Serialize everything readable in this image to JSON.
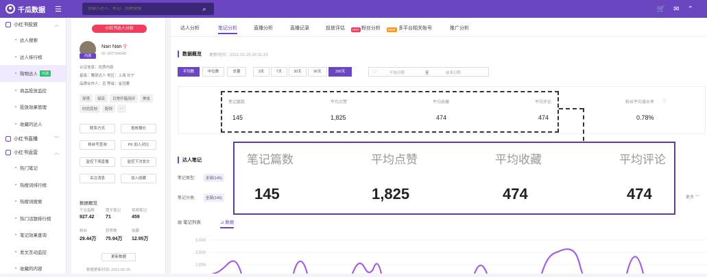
{
  "app": {
    "name": "千瓜数据"
  },
  "search": {
    "placeholder": "请输入达人、笔记、品牌搜搜"
  },
  "sidebar": {
    "sections": [
      {
        "label": "小红书投放"
      },
      {
        "label": "小红书直播"
      },
      {
        "label": "小红书运营"
      }
    ],
    "group1": [
      {
        "label": "达人搜索"
      },
      {
        "label": "达人排行榜"
      },
      {
        "label": "购物达人",
        "badge": "内测"
      },
      {
        "label": "商品投放监控"
      },
      {
        "label": "投放效果管理"
      },
      {
        "label": "收藏的达人"
      }
    ],
    "group3": [
      {
        "label": "热门笔记"
      },
      {
        "label": "热搜词排行榜"
      },
      {
        "label": "热搜词搜索"
      },
      {
        "label": "热门话题排行榜"
      },
      {
        "label": "笔记效果查询"
      },
      {
        "label": "发文互动监控"
      },
      {
        "label": "收藏的内容"
      }
    ]
  },
  "profile": {
    "tag": "小红书达人分析",
    "name": "Nan Nan",
    "id": "ID: 907794345",
    "avatar_badge": "内测",
    "info": [
      "认证信息：优质内容",
      "星级：腰部达人   地区：上海 长宁",
      "品牌合作人：否   等级：金冠薯"
    ],
    "chips": [
      "穿搭",
      "探店",
      "日常开箱测评",
      "美妆",
      "时尚其他",
      "配饰",
      "..."
    ],
    "buttons": [
      "联系方式",
      "投放报价",
      "粉丝号查询",
      "PK 加入对比",
      "监控下场直播",
      "监控下次发文",
      "关注消息",
      "加入收藏"
    ],
    "stats_title": "数据概览",
    "stats": [
      {
        "label": "千瓜指数",
        "value": "927.42"
      },
      {
        "label": "图文笔记",
        "value": "71"
      },
      {
        "label": "视频笔记",
        "value": "459"
      },
      {
        "label": "粉丝",
        "value": "29.44万"
      },
      {
        "label": "获赞数",
        "value": "75.94万"
      },
      {
        "label": "收藏",
        "value": "12.95万"
      }
    ],
    "refresh": "更新数据",
    "update_time": "数据更新时间: 2021-02-25"
  },
  "tabs": [
    {
      "label": "达人分析"
    },
    {
      "label": "笔记分析",
      "active": true
    },
    {
      "label": "直播分析"
    },
    {
      "label": "直播记录"
    },
    {
      "label": "投放评估",
      "badge": "HOT"
    },
    {
      "label": "粉丝分析",
      "badge": "NEW"
    },
    {
      "label": "多平台相关账号"
    },
    {
      "label": "推广分析"
    }
  ],
  "overview": {
    "title": "数据概览",
    "update": "更新时间：2021-02-25 00:31:23",
    "segments": [
      "平均数",
      "中位数",
      "总量",
      "3天",
      "7天",
      "30天",
      "90天",
      "180天"
    ],
    "date_start": "开始日期",
    "date_sep": "至",
    "date_end": "结束日期",
    "metrics": [
      {
        "label": "笔记篇数",
        "value": "145"
      },
      {
        "label": "平均点赞",
        "value": "1,825"
      },
      {
        "label": "平均收藏",
        "value": "474"
      },
      {
        "label": "平均评论",
        "value": "474"
      },
      {
        "label": "粉丝平均增长率",
        "value": "0.78%"
      }
    ]
  },
  "zoom": {
    "metrics": [
      {
        "label": "笔记篇数",
        "value": "145"
      },
      {
        "label": "平均点赞",
        "value": "1,825"
      },
      {
        "label": "平均收藏",
        "value": "474"
      },
      {
        "label": "平均评论",
        "value": "474"
      }
    ]
  },
  "notes": {
    "title": "达人笔记",
    "type_label": "笔记类型:",
    "type_value": "全部(145)",
    "cat_label": "笔记分类:",
    "cat_value": "全部(145)",
    "more": "更多",
    "subtabs": [
      "笔记列表",
      "数据"
    ]
  },
  "chart_data": {
    "type": "line",
    "y_ticks": [
      "3,000",
      "2,500",
      "2,000"
    ],
    "ylim": [
      2000,
      3000
    ]
  },
  "colors": {
    "primary": "#6b46c1",
    "chart_line": "#a45ee0"
  }
}
